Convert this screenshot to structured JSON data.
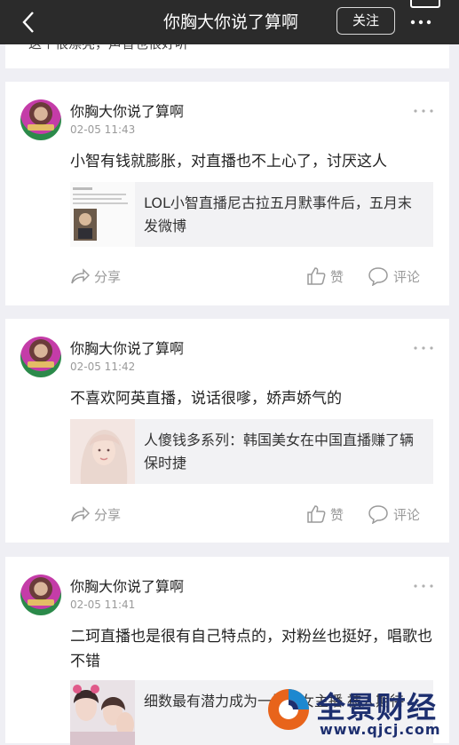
{
  "header": {
    "title": "你胸大你说了算啊",
    "follow_label": "关注"
  },
  "previous_card": {
    "text": "这个很漂亮，声音也很好听"
  },
  "posts": [
    {
      "username": "你胸大你说了算啊",
      "time": "02-05 11:43",
      "content": "小智有钱就膨胀，对直播也不上心了，讨厌这人",
      "link_title": "LOL小智直播尼古拉五月默事件后，五月末发微博",
      "share_label": "分享",
      "like_label": "赞",
      "comment_label": "评论"
    },
    {
      "username": "你胸大你说了算啊",
      "time": "02-05 11:42",
      "content": "不喜欢阿英直播，说话很嗲，娇声娇气的",
      "link_title": "人傻钱多系列：韩国美女在中国直播赚了辆保时捷",
      "share_label": "分享",
      "like_label": "赞",
      "comment_label": "评论"
    },
    {
      "username": "你胸大你说了算啊",
      "time": "02-05 11:41",
      "content": "二珂直播也是很有自己特点的，对粉丝也挺好，唱歌也不错",
      "link_title": "细数最有潜力成为一姐的女主播 被人期待",
      "share_label": "分享",
      "like_label": "赞",
      "comment_label": "评论"
    }
  ],
  "watermark": {
    "brand": "全景财经",
    "url": "www.qjcj.com"
  },
  "colors": {
    "topbar": "#2b2b2b",
    "background": "#efeff4",
    "muted": "#9a9a9a",
    "brand": "#1d2f6f"
  }
}
